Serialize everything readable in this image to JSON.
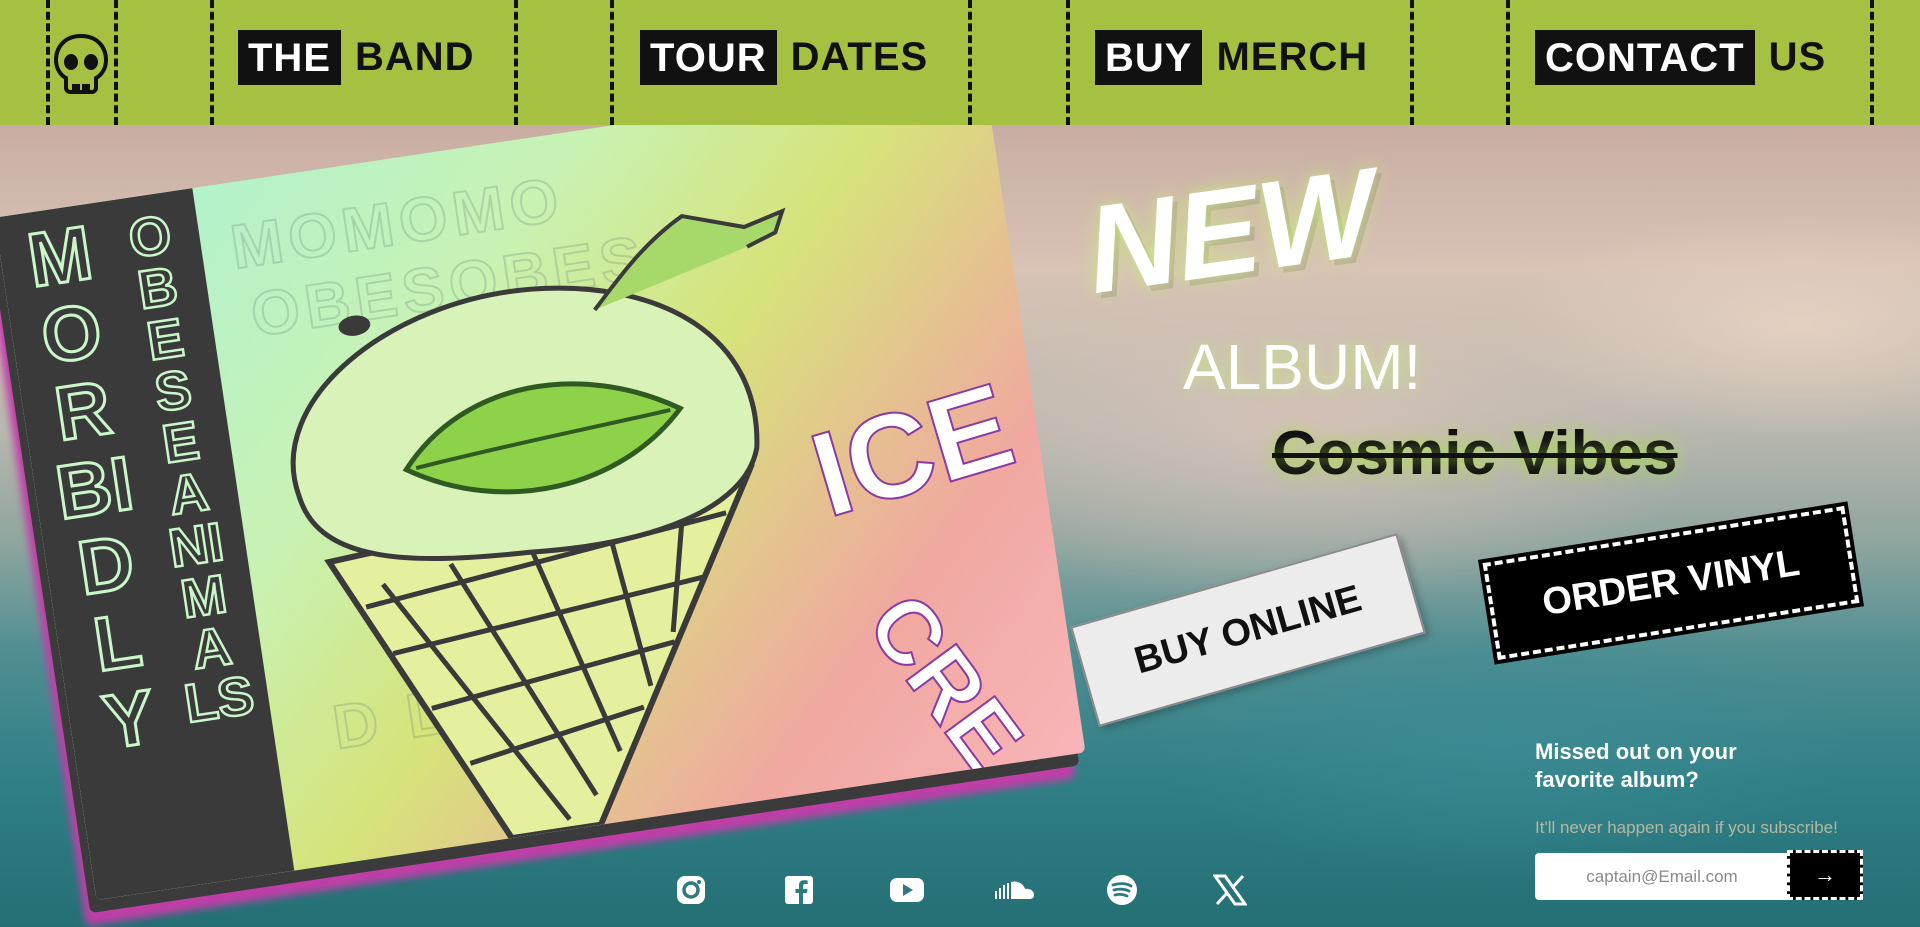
{
  "nav": {
    "items": [
      {
        "block": "THE",
        "rest": "BAND"
      },
      {
        "block": "TOUR",
        "rest": "DATES"
      },
      {
        "block": "BUY",
        "rest": "MERCH"
      },
      {
        "block": "CONTACT",
        "rest": "US"
      }
    ]
  },
  "album": {
    "band_word1": "MORBIDLY",
    "band_word2": "OBESE ANIMALS",
    "cover_title": "ICE CREAM"
  },
  "hero": {
    "new": "NEW",
    "album_word": "ALBUM!",
    "old_title": "Cosmic Vibes",
    "buy_online": "BUY ONLINE",
    "order_vinyl": "ORDER VINYL"
  },
  "subscribe": {
    "title": "Missed out on your favorite album?",
    "note": "It'll never happen again if you subscribe!",
    "placeholder": "captain@Email.com",
    "submit_icon": "→"
  },
  "social": [
    "instagram-icon",
    "facebook-icon",
    "youtube-icon",
    "soundcloud-icon",
    "spotify-icon",
    "x-icon"
  ],
  "colors": {
    "nav_bg": "#a6c142",
    "accent_pink": "#c03ea8",
    "ink": "#111111"
  }
}
